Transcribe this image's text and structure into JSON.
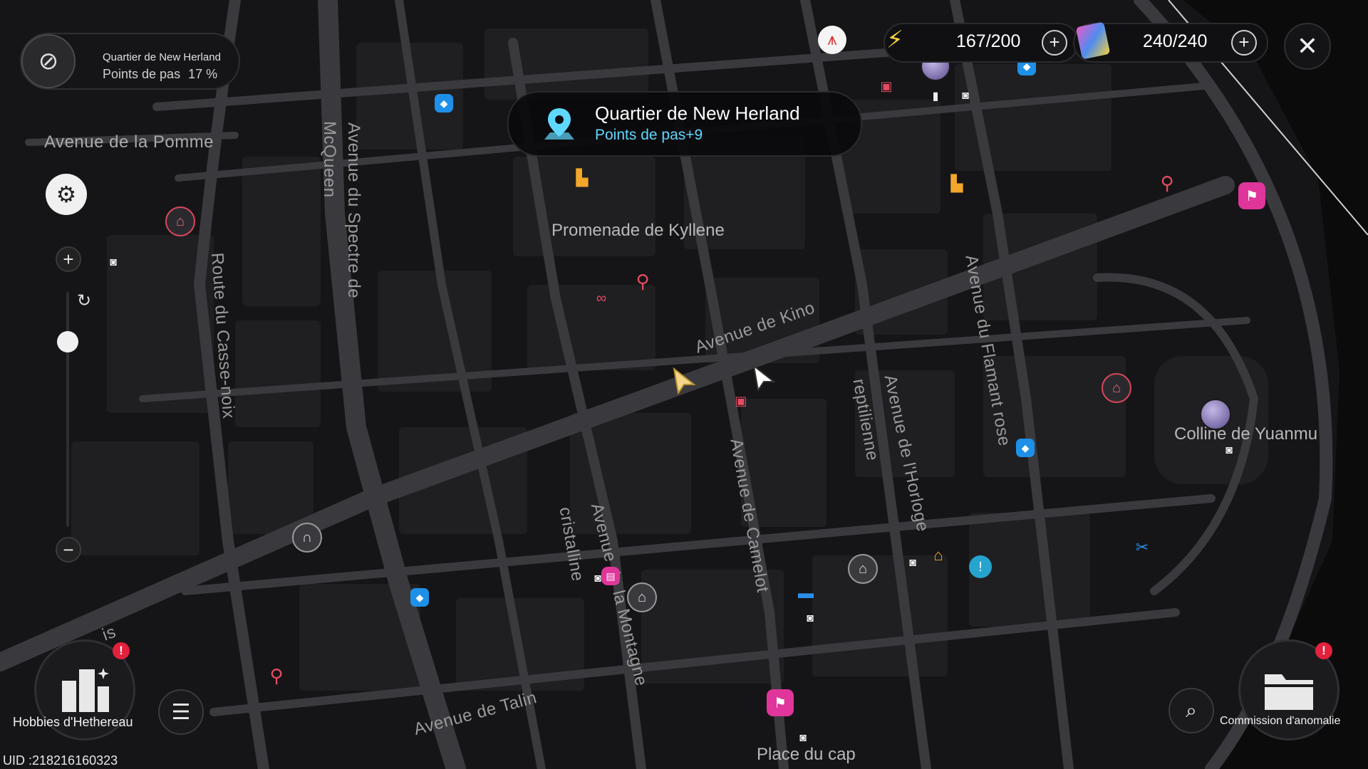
{
  "district_panel": {
    "title": "Quartier de New Herland",
    "progress_label": "Points de pas",
    "progress_value": "17 %",
    "compass_icon": "compass-icon"
  },
  "banner": {
    "title": "Quartier de New Herland",
    "subtitle": "Points de pas+9",
    "icon": "location-pin-icon"
  },
  "resources": {
    "energy": {
      "value": "167/200",
      "icon": "battery-charge-icon"
    },
    "tickets": {
      "value": "240/240",
      "icon": "film-ticket-icon"
    }
  },
  "streets": {
    "pomme": "Avenue de la Pomme",
    "mcqueen": "McQueen",
    "spectre": "Avenue du Spectre de",
    "casse_noix": "Route du Casse-noix",
    "kino": "Avenue de Kino",
    "camelot": "Avenue de Camelot",
    "reptilienne": "reptilienne",
    "horloge": "Avenue de l'Horloge",
    "flamant": "Avenue du Flamant rose",
    "cristalline": "cristalline",
    "montagne": "Avenue de la Montagne",
    "talin": "Avenue de Talin",
    "is": "is"
  },
  "districts": {
    "kyllene": "Promenade de Kyllene",
    "yuanmu": "Colline de Yuanmu",
    "cap": "Place du cap"
  },
  "bottom": {
    "hobbies_label": "Hobbies d'Hethereau",
    "commission_label": "Commission d'anomalie",
    "notif_mark": "!",
    "uid": "UID :218216160323"
  },
  "colors": {
    "accent_cyan": "#5fd8ff",
    "poi_red": "#e34b60",
    "poi_blue": "#1e90e8",
    "poi_orange": "#f2a72b",
    "poi_magenta": "#e0359a"
  }
}
